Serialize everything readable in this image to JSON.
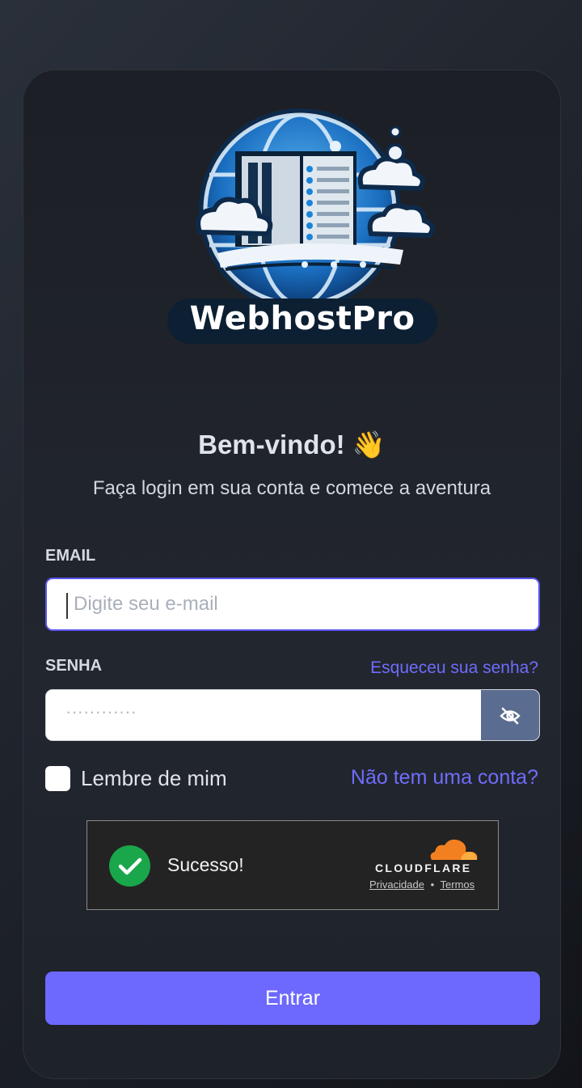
{
  "brand": {
    "logo_text": "WebhostPro"
  },
  "header": {
    "welcome": "Bem-vindo! 👋",
    "subtitle": "Faça login em sua conta e comece a aventura"
  },
  "form": {
    "email_label": "EMAIL",
    "email_placeholder": "Digite seu e-mail",
    "password_label": "SENHA",
    "forgot_link": "Esqueceu sua senha?",
    "password_placeholder": "············",
    "remember_label": "Lembre de mim",
    "signup_link": "Não tem uma conta?",
    "submit_label": "Entrar"
  },
  "captcha": {
    "status": "Sucesso!",
    "provider": "CLOUDFLARE",
    "privacy": "Privacidade",
    "separator": "•",
    "terms": "Termos"
  },
  "colors": {
    "accent": "#6d69ff",
    "link": "#6f6dfb",
    "success": "#1aa64a",
    "eye_button": "#5a6c8f",
    "cloudflare_orange": "#f38020"
  },
  "icons": {
    "toggle_password": "eye-off-icon",
    "captcha_status": "check-circle-icon",
    "provider_logo": "cloudflare-cloud-icon"
  }
}
